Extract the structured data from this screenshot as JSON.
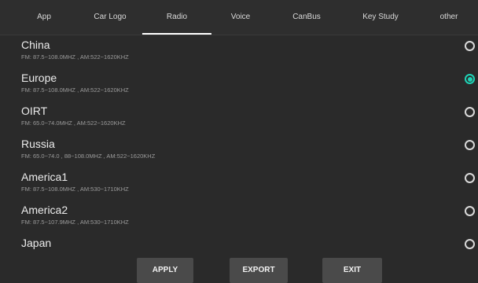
{
  "tabs": [
    {
      "label": "App"
    },
    {
      "label": "Car Logo"
    },
    {
      "label": "Radio",
      "active": true
    },
    {
      "label": "Voice"
    },
    {
      "label": "CanBus"
    },
    {
      "label": "Key Study"
    },
    {
      "label": "other"
    }
  ],
  "regions": [
    {
      "name": "China",
      "freq": "FM: 87.5~108.0MHZ , AM:522~1620KHZ",
      "selected": false
    },
    {
      "name": "Europe",
      "freq": "FM: 87.5~108.0MHZ , AM:522~1620KHZ",
      "selected": true
    },
    {
      "name": "OIRT",
      "freq": "FM: 65.0~74.0MHZ , AM:522~1620KHZ",
      "selected": false
    },
    {
      "name": "Russia",
      "freq": "FM: 65.0~74.0 , 88~108.0MHZ , AM:522~1620KHZ",
      "selected": false
    },
    {
      "name": "America1",
      "freq": "FM: 87.5~108.0MHZ , AM:530~1710KHZ",
      "selected": false
    },
    {
      "name": "America2",
      "freq": "FM: 87.5~107.9MHZ , AM:530~1710KHZ",
      "selected": false
    },
    {
      "name": "Japan",
      "freq": "",
      "selected": false
    }
  ],
  "buttons": {
    "apply": "APPLY",
    "export": "EXPORT",
    "exit": "EXIT"
  },
  "colors": {
    "accent": "#1fd3b6",
    "background": "#2a2a2a"
  }
}
